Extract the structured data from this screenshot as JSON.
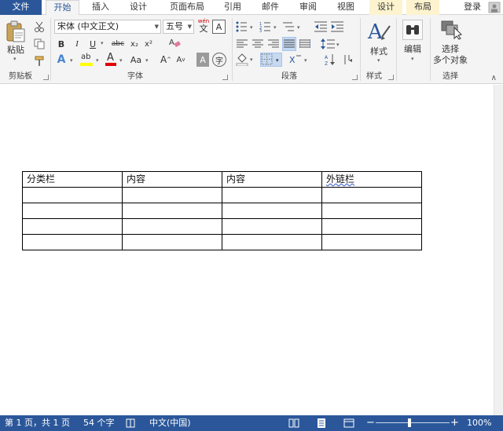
{
  "tabs": {
    "file": "文件",
    "home": "开始",
    "insert": "插入",
    "design": "设计",
    "layout": "页面布局",
    "references": "引用",
    "mailings": "邮件",
    "review": "审阅",
    "view": "视图",
    "table_design": "设计",
    "table_layout": "布局",
    "login": "登录"
  },
  "clipboard": {
    "paste_label": "粘贴",
    "group_label": "剪贴板"
  },
  "font": {
    "font_name": "宋体 (中文正文)",
    "font_size": "五号",
    "pinyin_top": "wén",
    "pinyin_char": "文",
    "border_char": "A",
    "bold": "B",
    "italic": "I",
    "underline": "U",
    "strike": "abc",
    "subscript": "x₂",
    "superscript": "x²",
    "text_effect": "A",
    "highlight": "ab",
    "font_color": "A",
    "change_case": "Aa",
    "grow_font": "A",
    "shrink_font": "A",
    "char_shading": "A",
    "enclose_char": "字",
    "group_label": "字体"
  },
  "paragraph": {
    "group_label": "段落"
  },
  "styles": {
    "label": "样式",
    "group_label": "样式"
  },
  "editing": {
    "label": "编辑"
  },
  "select": {
    "label_line1": "选择",
    "label_line2": "多个对象",
    "group_label": "选择"
  },
  "document": {
    "table": [
      [
        "分类栏",
        "内容",
        "内容",
        "外链栏"
      ],
      [
        "",
        "",
        "",
        ""
      ],
      [
        "",
        "",
        "",
        ""
      ],
      [
        "",
        "",
        "",
        ""
      ],
      [
        "",
        "",
        "",
        ""
      ]
    ]
  },
  "status": {
    "page": "第 1 页，共 1 页",
    "words": "54 个字",
    "language": "中文(中国)",
    "zoom": "100%",
    "zoom_minus": "−",
    "zoom_plus": "+"
  },
  "colors": {
    "accent": "#2b579a",
    "highlight_yellow": "#ffff00",
    "font_red": "#e00000",
    "selected_button": "#c5d9f1"
  }
}
